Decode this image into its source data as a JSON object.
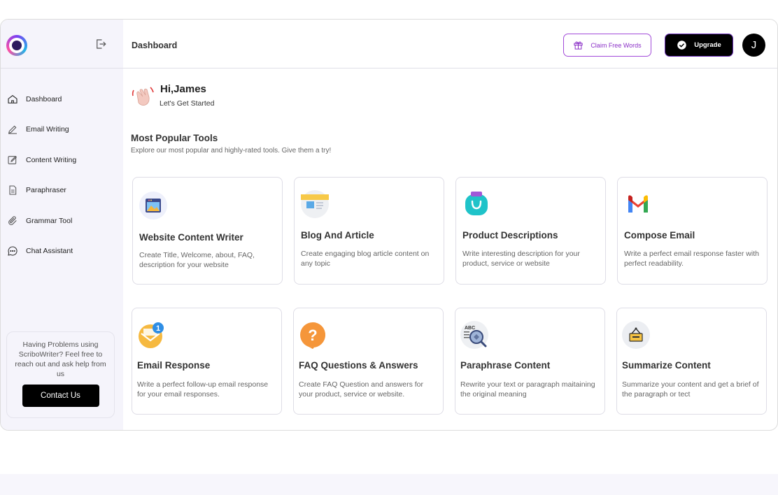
{
  "header": {
    "title": "Dashboard",
    "claim_label": "Claim Free Words",
    "upgrade_label": "Upgrade",
    "avatar_initial": "J"
  },
  "sidebar": {
    "items": [
      {
        "label": "Dashboard",
        "icon": "home-icon"
      },
      {
        "label": "Email Writing",
        "icon": "pen-icon"
      },
      {
        "label": "Content Writing",
        "icon": "edit-icon"
      },
      {
        "label": "Paraphraser",
        "icon": "document-icon"
      },
      {
        "label": "Grammar Tool",
        "icon": "paperclip-icon"
      },
      {
        "label": "Chat Assistant",
        "icon": "chat-icon"
      }
    ],
    "help_text": "Having Problems using ScriboWriter? Feel free to reach out and ask help from us",
    "contact_label": "Contact Us"
  },
  "greeting": {
    "title": "Hi,James",
    "subtitle": "Let's Get Started"
  },
  "tools_section": {
    "title": "Most Popular Tools",
    "subtitle": "Explore our most popular and highly-rated tools. Give them a try!"
  },
  "tools": [
    {
      "title": "Website Content Writer",
      "desc": "Create Title, Welcome, about, FAQ, description for your website",
      "icon": "website-icon"
    },
    {
      "title": "Blog And Article",
      "desc": "Create engaging blog article content on any topic",
      "icon": "blog-icon"
    },
    {
      "title": "Product Descriptions",
      "desc": "Write interesting description for your product, service or website",
      "icon": "shopping-bag-icon"
    },
    {
      "title": "Compose Email",
      "desc": "Write a perfect email response faster with perfect readability.",
      "icon": "gmail-icon"
    },
    {
      "title": "Email Response",
      "desc": "Write a perfect follow-up email response for your email responses.",
      "icon": "envelope-notification-icon"
    },
    {
      "title": "FAQ Questions & Answers",
      "desc": "Create FAQ Question and answers for your product, service or website.",
      "icon": "question-icon"
    },
    {
      "title": "Paraphrase Content",
      "desc": "Rewrite your text or paragraph maitaining the original meaning",
      "icon": "magnifier-text-icon"
    },
    {
      "title": "Summarize Content",
      "desc": "Summarize your content and get a brief of the paragraph or tect",
      "icon": "sign-icon"
    }
  ],
  "colors": {
    "accent": "#8a2fc7",
    "sidebar_bg": "#f5f4fb",
    "primary_button": "#000000"
  }
}
